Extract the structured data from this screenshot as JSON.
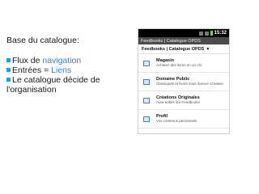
{
  "slide": {
    "title": "Base du catalogue:",
    "bullets": [
      {
        "prefix": "Flux de ",
        "highlight": "navigation"
      },
      {
        "prefix": "Entrées = ",
        "highlight": "Liens"
      },
      {
        "prefix": "Le catalogue décide de",
        "highlight": ""
      }
    ],
    "continuation": "l'organisation"
  },
  "phone": {
    "status_time": "15:32",
    "app_title": "Feedbooks | Catalogue OPDS",
    "breadcrumb": "Feedbooks | Catalogue OPDS",
    "breadcrumb_arrow": "▼",
    "items": [
      {
        "title": "Magasin",
        "subtitle": "Achetez des livres en un clic",
        "icon": "book-icon"
      },
      {
        "title": "Domaine Public",
        "subtitle": "Classiques et livres sous licence Creative",
        "icon": "book-icon"
      },
      {
        "title": "Créations Originales",
        "subtitle": "Auto-édités sur Feedbooks",
        "icon": "book-icon"
      },
      {
        "title": "Profil",
        "subtitle": "Vos contenus personnels",
        "icon": "book-icon"
      }
    ]
  },
  "colors": {
    "accent": "#3b7fc4",
    "bullet": "#2a9fd6"
  }
}
